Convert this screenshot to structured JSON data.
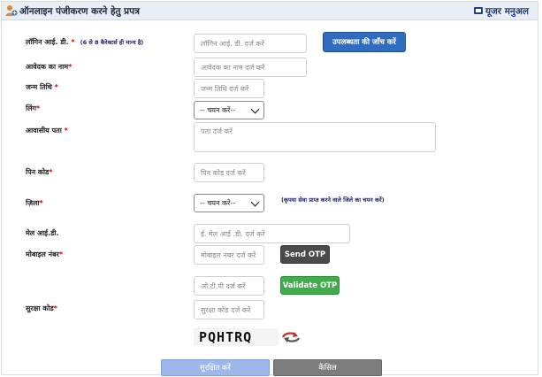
{
  "header": {
    "title": "ऑनलाइन पंजीकरण करने हेतु प्रपत्र",
    "user_manual": "यूजर मनुअल"
  },
  "form": {
    "login_id": {
      "label": "लॉगिन आई. डी.",
      "required": "*",
      "hint": "(6 से 8 कैरेक्टर्स ही मान्य है)",
      "placeholder": "लॉगिन आई. डी. दर्ज करें",
      "check_button": "उपलब्धता की जाँच करें"
    },
    "applicant_name": {
      "label": "आवेदक का नाम",
      "required": "*",
      "placeholder": "आवेदक का नाम दर्ज करें"
    },
    "dob": {
      "label": "जन्म तिथि",
      "required": "*",
      "placeholder": "जन्म तिथि दर्ज करें"
    },
    "gender": {
      "label": "लिंग",
      "required": "*",
      "selected": "-- चयन करें--"
    },
    "address": {
      "label": "आवासीय पता",
      "required": "*",
      "placeholder": "पता दर्ज करें"
    },
    "pincode": {
      "label": "पिन कोड",
      "required": "*",
      "placeholder": "पिन कोड दर्ज करें"
    },
    "district": {
      "label": "ज़िला",
      "required": "*",
      "selected": "-- चयन करें--",
      "note": "(कृपया सेवा प्राप्त करने वाले जिले का चयन करें)"
    },
    "email": {
      "label": "मेल आई.डी.",
      "placeholder": "ई. मेल आई .डी. दर्ज करें"
    },
    "mobile": {
      "label": "मोबाइल नंबर",
      "required": "*",
      "placeholder": "मोबाइल नंबर दर्ज करें",
      "send_otp": "Send OTP"
    },
    "otp": {
      "placeholder": "ओ.टी.पी दर्ज करें",
      "validate_otp": "Validate OTP"
    },
    "security_code": {
      "label": "सुरक्षा कोड",
      "required": "*",
      "placeholder": "सुरक्षा कोड दर्ज करें",
      "captcha_text": "PQHTRQ"
    }
  },
  "footer": {
    "save": "सुरक्षित करें",
    "cancel": "कैंसिल"
  },
  "colors": {
    "header_bg": "#e9eef4",
    "primary_button": "#2f6bbf",
    "send_otp_button": "#4a4a4a",
    "validate_button": "#3fae4a",
    "save_button": "#9cb7e8",
    "cancel_button": "#7d7d7d",
    "required_mark": "#dd0000"
  }
}
